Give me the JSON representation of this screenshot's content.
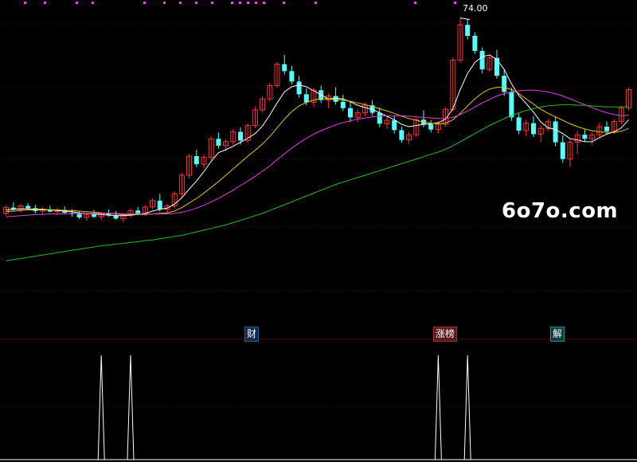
{
  "watermark": "6o7o.com",
  "tags": {
    "cai": "财",
    "zhang": "涨榜",
    "jie": "解"
  },
  "peak_label": "74.00",
  "colors": {
    "background": "#000000",
    "up_candle": "#ff3232",
    "down_candle": "#54ffff",
    "ma_short": "#ffffff",
    "ma_mid": "#e8c600",
    "ma_long": "#e040e0",
    "ma_longer": "#20c020",
    "grid": "#3a0000",
    "signal": "#ffffff",
    "top_markers": "#ff40ff"
  },
  "chart_data": [
    {
      "type": "candlestick",
      "name": "price",
      "notes": "Estimated price candles (no axis labels printed). Highest marked point 74.00.",
      "ylim": [
        22,
        76
      ],
      "candles": [
        [
          40.2,
          41.6,
          39.8,
          41.2
        ],
        [
          41.2,
          42.1,
          40.5,
          40.9
        ],
        [
          40.9,
          41.8,
          40.3,
          41.5
        ],
        [
          41.5,
          42.0,
          40.9,
          41.1
        ],
        [
          41.1,
          41.7,
          40.2,
          40.6
        ],
        [
          40.6,
          41.3,
          40.0,
          40.9
        ],
        [
          40.9,
          41.5,
          40.4,
          40.5
        ],
        [
          40.5,
          41.2,
          39.9,
          40.8
        ],
        [
          40.8,
          41.4,
          40.2,
          40.3
        ],
        [
          40.3,
          40.9,
          39.6,
          40.1
        ],
        [
          40.1,
          40.6,
          39.2,
          39.5
        ],
        [
          39.5,
          40.3,
          38.9,
          40.0
        ],
        [
          40.0,
          40.8,
          39.4,
          39.6
        ],
        [
          39.6,
          40.4,
          39.0,
          40.2
        ],
        [
          40.2,
          40.9,
          39.6,
          39.9
        ],
        [
          39.9,
          40.6,
          39.1,
          39.3
        ],
        [
          39.3,
          40.2,
          38.7,
          39.9
        ],
        [
          39.9,
          41.0,
          39.5,
          40.7
        ],
        [
          40.7,
          41.3,
          39.9,
          40.2
        ],
        [
          40.2,
          41.6,
          39.8,
          41.3
        ],
        [
          41.3,
          42.8,
          40.9,
          42.4
        ],
        [
          42.4,
          43.6,
          40.5,
          40.9
        ],
        [
          40.9,
          41.8,
          40.1,
          41.5
        ],
        [
          41.5,
          44.0,
          41.0,
          43.6
        ],
        [
          43.6,
          47.2,
          43.1,
          46.8
        ],
        [
          46.8,
          50.5,
          46.2,
          50.1
        ],
        [
          50.1,
          51.2,
          48.2,
          48.7
        ],
        [
          48.7,
          50.4,
          48.0,
          49.9
        ],
        [
          49.9,
          53.5,
          49.4,
          53.1
        ],
        [
          53.1,
          54.2,
          51.4,
          51.9
        ],
        [
          51.9,
          53.0,
          51.0,
          52.6
        ],
        [
          52.6,
          54.8,
          52.0,
          54.3
        ],
        [
          54.3,
          55.1,
          52.1,
          52.8
        ],
        [
          52.8,
          55.8,
          52.4,
          55.4
        ],
        [
          55.4,
          58.7,
          55.0,
          58.1
        ],
        [
          58.1,
          60.5,
          57.6,
          60.0
        ],
        [
          60.0,
          62.8,
          59.6,
          62.3
        ],
        [
          62.3,
          66.4,
          61.9,
          66.0
        ],
        [
          66.0,
          67.6,
          64.2,
          64.8
        ],
        [
          64.8,
          65.7,
          62.5,
          63.0
        ],
        [
          63.0,
          64.0,
          60.2,
          60.8
        ],
        [
          60.8,
          61.8,
          58.9,
          59.4
        ],
        [
          59.4,
          61.9,
          58.6,
          61.5
        ],
        [
          61.5,
          62.3,
          59.3,
          59.8
        ],
        [
          59.8,
          61.0,
          58.4,
          60.5
        ],
        [
          60.5,
          62.0,
          59.0,
          59.5
        ],
        [
          59.5,
          60.7,
          57.9,
          58.4
        ],
        [
          58.4,
          59.6,
          56.0,
          56.8
        ],
        [
          56.8,
          58.2,
          56.0,
          57.6
        ],
        [
          57.6,
          59.4,
          57.0,
          58.9
        ],
        [
          58.9,
          59.8,
          57.1,
          57.6
        ],
        [
          57.6,
          58.5,
          55.1,
          55.7
        ],
        [
          55.7,
          57.0,
          54.8,
          56.3
        ],
        [
          56.3,
          57.1,
          54.0,
          54.6
        ],
        [
          54.6,
          55.2,
          52.4,
          52.9
        ],
        [
          52.9,
          54.3,
          52.2,
          53.8
        ],
        [
          53.8,
          56.8,
          53.4,
          56.4
        ],
        [
          56.4,
          58.0,
          55.1,
          55.6
        ],
        [
          55.6,
          56.3,
          54.2,
          54.7
        ],
        [
          54.7,
          56.0,
          54.0,
          55.6
        ],
        [
          55.6,
          58.6,
          55.2,
          58.2
        ],
        [
          58.2,
          67.2,
          57.8,
          66.7
        ],
        [
          66.7,
          74.0,
          66.2,
          72.8
        ],
        [
          72.8,
          73.8,
          70.3,
          70.9
        ],
        [
          70.9,
          71.5,
          67.8,
          68.3
        ],
        [
          68.3,
          68.9,
          64.4,
          65.1
        ],
        [
          65.1,
          67.6,
          64.7,
          67.1
        ],
        [
          67.1,
          68.5,
          63.5,
          64.0
        ],
        [
          64.0,
          65.1,
          60.5,
          61.2
        ],
        [
          61.2,
          61.9,
          56.2,
          56.8
        ],
        [
          56.8,
          57.5,
          53.9,
          54.5
        ],
        [
          54.5,
          56.4,
          53.5,
          55.8
        ],
        [
          55.8,
          57.0,
          53.4,
          53.9
        ],
        [
          53.9,
          55.5,
          52.5,
          54.9
        ],
        [
          54.9,
          56.5,
          54.4,
          56.1
        ],
        [
          56.1,
          57.0,
          51.8,
          52.5
        ],
        [
          52.5,
          53.7,
          49.0,
          49.6
        ],
        [
          49.6,
          53.1,
          48.2,
          52.5
        ],
        [
          52.5,
          54.5,
          50.5,
          53.8
        ],
        [
          53.8,
          54.7,
          52.6,
          53.1
        ],
        [
          53.1,
          54.3,
          52.0,
          53.8
        ],
        [
          53.8,
          55.8,
          53.3,
          55.2
        ],
        [
          55.2,
          56.1,
          53.8,
          54.4
        ],
        [
          54.4,
          56.5,
          53.9,
          56.1
        ],
        [
          56.1,
          58.8,
          55.6,
          58.4
        ],
        [
          58.4,
          62.0,
          58.0,
          61.6
        ]
      ]
    },
    {
      "type": "line",
      "name": "moving averages",
      "series": [
        {
          "values": [
            40.8,
            40.9,
            41.0,
            41.0,
            40.9,
            40.9,
            40.8,
            40.7,
            40.6,
            40.5,
            40.3,
            40.2,
            40.1,
            40.0,
            39.9,
            39.8,
            39.8,
            39.9,
            40.0,
            40.2,
            40.6,
            40.9,
            41.1,
            41.8,
            42.9,
            44.4,
            45.8,
            47.4,
            49.2,
            50.7,
            51.2,
            51.8,
            52.5,
            53.2,
            54.0,
            55.3,
            57.2,
            59.3,
            61.2,
            62.1,
            62.4,
            62.1,
            61.4,
            60.7,
            60.0,
            60.1,
            60.0,
            59.5,
            58.9,
            58.5,
            58.2,
            57.6,
            57.0,
            56.4,
            55.6,
            55.2,
            55.4,
            55.6,
            55.7,
            55.9,
            56.5,
            58.3,
            61.6,
            64.4,
            66.3,
            67.3,
            67.6,
            66.8,
            65.1,
            62.6,
            60.6,
            59.2,
            57.7,
            56.0,
            55.0,
            54.7,
            54.0,
            53.1,
            52.9,
            52.6,
            52.6,
            53.3,
            53.9,
            54.3,
            55.0,
            56.4
          ]
        },
        {
          "values": [
            40.5,
            40.6,
            40.7,
            40.8,
            40.8,
            40.8,
            40.8,
            40.8,
            40.7,
            40.7,
            40.6,
            40.5,
            40.4,
            40.3,
            40.2,
            40.1,
            40.0,
            40.0,
            40.0,
            40.0,
            40.1,
            40.2,
            40.3,
            40.6,
            41.2,
            42.0,
            42.8,
            43.7,
            44.7,
            45.7,
            46.8,
            47.9,
            49.0,
            50.1,
            51.1,
            52.2,
            53.5,
            55.0,
            56.5,
            57.8,
            58.8,
            59.4,
            59.8,
            60.0,
            60.0,
            59.9,
            59.8,
            59.6,
            59.3,
            59.0,
            58.7,
            58.3,
            57.9,
            57.5,
            57.0,
            56.6,
            56.3,
            56.0,
            55.8,
            55.7,
            55.8,
            56.4,
            57.5,
            58.8,
            60.0,
            61.0,
            61.7,
            62.0,
            62.0,
            61.6,
            60.9,
            60.0,
            59.1,
            58.2,
            57.5,
            56.9,
            56.3,
            55.7,
            55.2,
            54.8,
            54.5,
            54.3,
            54.2,
            54.2,
            54.4,
            54.9
          ]
        },
        {
          "values": [
            39.6,
            39.7,
            39.8,
            39.9,
            40.0,
            40.0,
            40.1,
            40.1,
            40.1,
            40.2,
            40.2,
            40.2,
            40.2,
            40.2,
            40.2,
            40.2,
            40.1,
            40.1,
            40.1,
            40.1,
            40.1,
            40.1,
            40.1,
            40.2,
            40.4,
            40.7,
            41.1,
            41.6,
            42.2,
            42.8,
            43.5,
            44.2,
            45.0,
            45.8,
            46.6,
            47.5,
            48.4,
            49.5,
            50.5,
            51.5,
            52.4,
            53.2,
            53.9,
            54.5,
            55.0,
            55.5,
            55.9,
            56.2,
            56.5,
            56.7,
            56.9,
            57.0,
            57.1,
            57.1,
            57.1,
            57.0,
            56.9,
            56.8,
            56.7,
            56.6,
            56.6,
            56.8,
            57.3,
            57.9,
            58.6,
            59.3,
            59.9,
            60.5,
            60.9,
            61.2,
            61.4,
            61.5,
            61.5,
            61.4,
            61.2,
            60.9,
            60.5,
            60.0,
            59.5,
            59.0,
            58.5,
            58.0,
            57.6,
            57.3,
            57.1,
            57.2
          ]
        },
        {
          "values": [
            32.0,
            32.2,
            32.4,
            32.6,
            32.8,
            33.0,
            33.2,
            33.4,
            33.6,
            33.8,
            34.0,
            34.2,
            34.4,
            34.6,
            34.7,
            34.9,
            35.0,
            35.2,
            35.3,
            35.5,
            35.6,
            35.8,
            36.0,
            36.2,
            36.4,
            36.7,
            37.0,
            37.3,
            37.6,
            37.9,
            38.2,
            38.6,
            39.0,
            39.4,
            39.8,
            40.2,
            40.7,
            41.2,
            41.7,
            42.2,
            42.7,
            43.2,
            43.7,
            44.2,
            44.7,
            45.2,
            45.6,
            46.0,
            46.4,
            46.8,
            47.2,
            47.6,
            48.0,
            48.4,
            48.8,
            49.2,
            49.6,
            50.0,
            50.4,
            50.8,
            51.3,
            51.9,
            52.6,
            53.3,
            54.0,
            54.7,
            55.4,
            56.0,
            56.6,
            57.1,
            57.6,
            58.0,
            58.3,
            58.6,
            58.8,
            58.9,
            59.0,
            59.0,
            58.9,
            58.9,
            58.8,
            58.7,
            58.6,
            58.6,
            58.6,
            58.7
          ]
        }
      ]
    },
    {
      "type": "line",
      "name": "signal",
      "notes": "Lower-pane pulse indicator: spikes where value is 1.",
      "ylim": [
        0,
        1.1
      ],
      "spikes": [
        13,
        17,
        59,
        63
      ],
      "length": 86
    }
  ]
}
